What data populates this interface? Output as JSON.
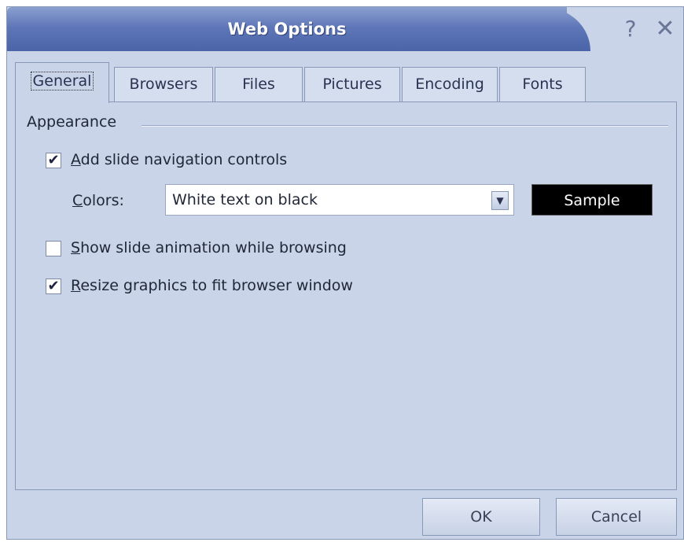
{
  "window": {
    "title": "Web Options",
    "help_glyph": "?",
    "close_glyph": "✕"
  },
  "tabs": [
    {
      "label": "General"
    },
    {
      "label": "Browsers"
    },
    {
      "label": "Files"
    },
    {
      "label": "Pictures"
    },
    {
      "label": "Encoding"
    },
    {
      "label": "Fonts"
    }
  ],
  "appearance": {
    "group_label": "Appearance",
    "nav_controls": {
      "prefix": "A",
      "rest": "dd slide navigation controls",
      "checked": true
    },
    "colors": {
      "label_prefix": "C",
      "label_rest": "olors:",
      "value": "White text on black",
      "sample_label": "Sample"
    },
    "animation": {
      "prefix": "S",
      "rest": "how slide animation while browsing",
      "checked": false
    },
    "resize": {
      "prefix": "R",
      "rest": "esize graphics to fit browser window",
      "checked": true
    }
  },
  "footer": {
    "ok_label": "OK",
    "cancel_label": "Cancel"
  },
  "icons": {
    "check": "check-icon",
    "dropdown": "chevron-down-icon"
  }
}
